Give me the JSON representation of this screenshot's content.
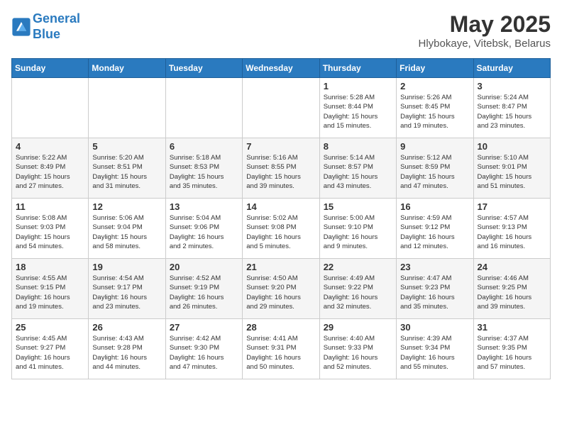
{
  "header": {
    "logo_line1": "General",
    "logo_line2": "Blue",
    "month": "May 2025",
    "location": "Hlybokaye, Vitebsk, Belarus"
  },
  "days_of_week": [
    "Sunday",
    "Monday",
    "Tuesday",
    "Wednesday",
    "Thursday",
    "Friday",
    "Saturday"
  ],
  "weeks": [
    [
      {
        "day": "",
        "info": ""
      },
      {
        "day": "",
        "info": ""
      },
      {
        "day": "",
        "info": ""
      },
      {
        "day": "",
        "info": ""
      },
      {
        "day": "1",
        "info": "Sunrise: 5:28 AM\nSunset: 8:44 PM\nDaylight: 15 hours\nand 15 minutes."
      },
      {
        "day": "2",
        "info": "Sunrise: 5:26 AM\nSunset: 8:45 PM\nDaylight: 15 hours\nand 19 minutes."
      },
      {
        "day": "3",
        "info": "Sunrise: 5:24 AM\nSunset: 8:47 PM\nDaylight: 15 hours\nand 23 minutes."
      }
    ],
    [
      {
        "day": "4",
        "info": "Sunrise: 5:22 AM\nSunset: 8:49 PM\nDaylight: 15 hours\nand 27 minutes."
      },
      {
        "day": "5",
        "info": "Sunrise: 5:20 AM\nSunset: 8:51 PM\nDaylight: 15 hours\nand 31 minutes."
      },
      {
        "day": "6",
        "info": "Sunrise: 5:18 AM\nSunset: 8:53 PM\nDaylight: 15 hours\nand 35 minutes."
      },
      {
        "day": "7",
        "info": "Sunrise: 5:16 AM\nSunset: 8:55 PM\nDaylight: 15 hours\nand 39 minutes."
      },
      {
        "day": "8",
        "info": "Sunrise: 5:14 AM\nSunset: 8:57 PM\nDaylight: 15 hours\nand 43 minutes."
      },
      {
        "day": "9",
        "info": "Sunrise: 5:12 AM\nSunset: 8:59 PM\nDaylight: 15 hours\nand 47 minutes."
      },
      {
        "day": "10",
        "info": "Sunrise: 5:10 AM\nSunset: 9:01 PM\nDaylight: 15 hours\nand 51 minutes."
      }
    ],
    [
      {
        "day": "11",
        "info": "Sunrise: 5:08 AM\nSunset: 9:03 PM\nDaylight: 15 hours\nand 54 minutes."
      },
      {
        "day": "12",
        "info": "Sunrise: 5:06 AM\nSunset: 9:04 PM\nDaylight: 15 hours\nand 58 minutes."
      },
      {
        "day": "13",
        "info": "Sunrise: 5:04 AM\nSunset: 9:06 PM\nDaylight: 16 hours\nand 2 minutes."
      },
      {
        "day": "14",
        "info": "Sunrise: 5:02 AM\nSunset: 9:08 PM\nDaylight: 16 hours\nand 5 minutes."
      },
      {
        "day": "15",
        "info": "Sunrise: 5:00 AM\nSunset: 9:10 PM\nDaylight: 16 hours\nand 9 minutes."
      },
      {
        "day": "16",
        "info": "Sunrise: 4:59 AM\nSunset: 9:12 PM\nDaylight: 16 hours\nand 12 minutes."
      },
      {
        "day": "17",
        "info": "Sunrise: 4:57 AM\nSunset: 9:13 PM\nDaylight: 16 hours\nand 16 minutes."
      }
    ],
    [
      {
        "day": "18",
        "info": "Sunrise: 4:55 AM\nSunset: 9:15 PM\nDaylight: 16 hours\nand 19 minutes."
      },
      {
        "day": "19",
        "info": "Sunrise: 4:54 AM\nSunset: 9:17 PM\nDaylight: 16 hours\nand 23 minutes."
      },
      {
        "day": "20",
        "info": "Sunrise: 4:52 AM\nSunset: 9:19 PM\nDaylight: 16 hours\nand 26 minutes."
      },
      {
        "day": "21",
        "info": "Sunrise: 4:50 AM\nSunset: 9:20 PM\nDaylight: 16 hours\nand 29 minutes."
      },
      {
        "day": "22",
        "info": "Sunrise: 4:49 AM\nSunset: 9:22 PM\nDaylight: 16 hours\nand 32 minutes."
      },
      {
        "day": "23",
        "info": "Sunrise: 4:47 AM\nSunset: 9:23 PM\nDaylight: 16 hours\nand 35 minutes."
      },
      {
        "day": "24",
        "info": "Sunrise: 4:46 AM\nSunset: 9:25 PM\nDaylight: 16 hours\nand 39 minutes."
      }
    ],
    [
      {
        "day": "25",
        "info": "Sunrise: 4:45 AM\nSunset: 9:27 PM\nDaylight: 16 hours\nand 41 minutes."
      },
      {
        "day": "26",
        "info": "Sunrise: 4:43 AM\nSunset: 9:28 PM\nDaylight: 16 hours\nand 44 minutes."
      },
      {
        "day": "27",
        "info": "Sunrise: 4:42 AM\nSunset: 9:30 PM\nDaylight: 16 hours\nand 47 minutes."
      },
      {
        "day": "28",
        "info": "Sunrise: 4:41 AM\nSunset: 9:31 PM\nDaylight: 16 hours\nand 50 minutes."
      },
      {
        "day": "29",
        "info": "Sunrise: 4:40 AM\nSunset: 9:33 PM\nDaylight: 16 hours\nand 52 minutes."
      },
      {
        "day": "30",
        "info": "Sunrise: 4:39 AM\nSunset: 9:34 PM\nDaylight: 16 hours\nand 55 minutes."
      },
      {
        "day": "31",
        "info": "Sunrise: 4:37 AM\nSunset: 9:35 PM\nDaylight: 16 hours\nand 57 minutes."
      }
    ]
  ]
}
